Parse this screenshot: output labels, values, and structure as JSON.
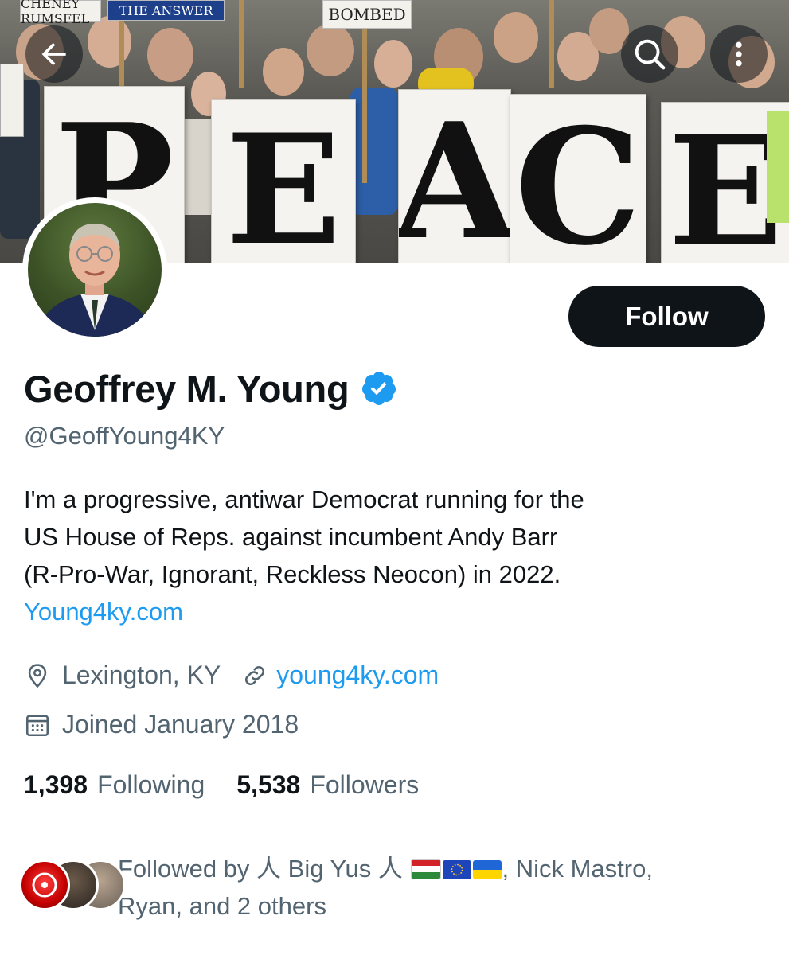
{
  "banner": {
    "signs_small": [
      "CHENEY RUMSFEL",
      "THE ANSWER",
      "BOMBED"
    ],
    "letters": [
      "P",
      "E",
      "A",
      "C",
      "E"
    ]
  },
  "nav": {
    "back_icon": "arrow-left-icon",
    "search_icon": "search-icon",
    "more_icon": "more-vertical-icon"
  },
  "profile": {
    "name": "Geoffrey M. Young",
    "handle": "@GeoffYoung4KY",
    "verified": true,
    "follow_label": "Follow",
    "bio_lines": [
      "I'm a progressive, antiwar Democrat running for the",
      "US House of Reps. against incumbent Andy Barr",
      "(R-Pro-War, Ignorant, Reckless Neocon) in 2022."
    ],
    "bio_link": "Young4ky.com",
    "location": "Lexington, KY",
    "website": "young4ky.com",
    "joined": "Joined January 2018"
  },
  "stats": {
    "following_count": "1,398",
    "following_label": "Following",
    "followers_count": "5,538",
    "followers_label": "Followers"
  },
  "followed_by": {
    "prefix": "Followed by",
    "name1": "人 Big Yus 人",
    "rest_line1": ", Nick Mastro,",
    "line2": "Ryan, and 2 others"
  },
  "colors": {
    "accent": "#1d9bf0",
    "text": "#0f1419",
    "muted": "#536471",
    "button_bg": "#0f1419"
  }
}
